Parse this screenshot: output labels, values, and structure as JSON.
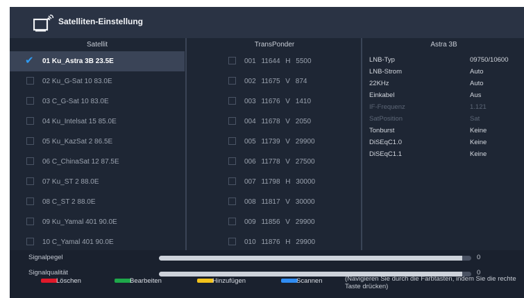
{
  "header": {
    "title": "Satelliten-Einstellung",
    "icon": "satellite-tv-icon"
  },
  "satellite_panel": {
    "heading": "Satellit",
    "items": [
      {
        "label": "01  Ku_Astra 3B 23.5E",
        "checked": true
      },
      {
        "label": "02  Ku_G-Sat 10 83.0E",
        "checked": false
      },
      {
        "label": "03  C_G-Sat 10 83.0E",
        "checked": false
      },
      {
        "label": "04  Ku_Intelsat 15 85.0E",
        "checked": false
      },
      {
        "label": "05  Ku_KazSat 2 86.5E",
        "checked": false
      },
      {
        "label": "06  C_ChinaSat 12 87.5E",
        "checked": false
      },
      {
        "label": "07  Ku_ST 2 88.0E",
        "checked": false
      },
      {
        "label": "08  C_ST 2 88.0E",
        "checked": false
      },
      {
        "label": "09  Ku_Yamal 401 90.0E",
        "checked": false
      },
      {
        "label": "10  C_Yamal 401 90.0E",
        "checked": false
      }
    ]
  },
  "transponder_panel": {
    "heading": "TransPonder",
    "items": [
      {
        "label": "001  11644  H  5500"
      },
      {
        "label": "002  11675  V  874"
      },
      {
        "label": "003  11676  V  1410"
      },
      {
        "label": "004  11678  V  2050"
      },
      {
        "label": "005  11739  V  29900"
      },
      {
        "label": "006  11778  V  27500"
      },
      {
        "label": "007  11798  H  30000"
      },
      {
        "label": "008  11817  V  30000"
      },
      {
        "label": "009  11856  V  29900"
      },
      {
        "label": "010  11876  H  29900"
      }
    ]
  },
  "info_panel": {
    "heading": "Astra 3B",
    "rows": [
      {
        "label": "LNB-Typ",
        "value": "09750/10600",
        "dim": false
      },
      {
        "label": "LNB-Strom",
        "value": "Auto",
        "dim": false
      },
      {
        "label": "22KHz",
        "value": "Auto",
        "dim": false
      },
      {
        "label": "Einkabel",
        "value": "Aus",
        "dim": false
      },
      {
        "label": "IF-Frequenz",
        "value": "1.121",
        "dim": true
      },
      {
        "label": "SatPosition",
        "value": "Sat",
        "dim": true
      },
      {
        "label": "Tonburst",
        "value": "Keine",
        "dim": false
      },
      {
        "label": "DiSEqC1.0",
        "value": "Keine",
        "dim": false
      },
      {
        "label": "DiSEqC1.1",
        "value": "Keine",
        "dim": false
      }
    ]
  },
  "signal": {
    "level_label": "Signalpegel",
    "level_value": "0",
    "level_fraction": 0.97,
    "quality_label": "Signalqualität",
    "quality_value": "0",
    "quality_fraction": 0.97
  },
  "legend": [
    {
      "label": "Löschen",
      "color": "#e0192a"
    },
    {
      "label": "Bearbeiten",
      "color": "#1ea84a"
    },
    {
      "label": "Hinzufügen",
      "color": "#f2c21b"
    },
    {
      "label": "Scannen",
      "color": "#2f8cf2"
    }
  ],
  "hint": "(Navigieren Sie durch die Farbtasten, indem Sie die rechte Taste drücken)"
}
